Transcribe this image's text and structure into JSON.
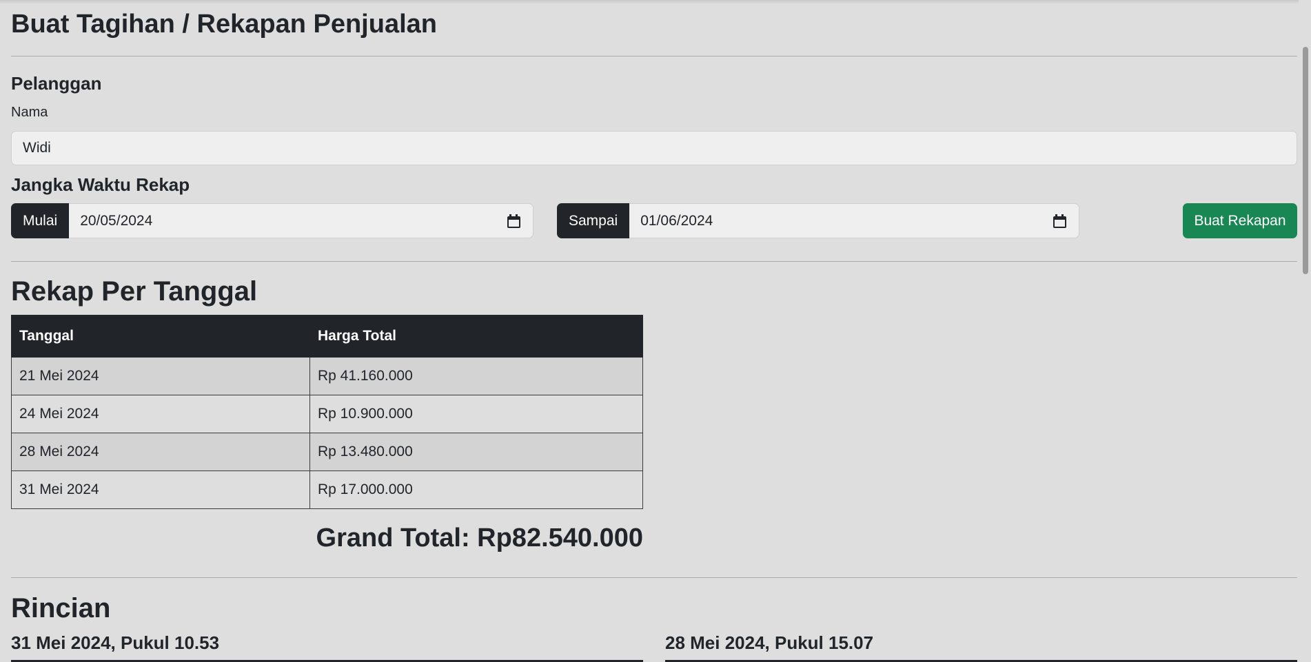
{
  "page": {
    "title": "Buat Tagihan / Rekapan Penjualan"
  },
  "customer": {
    "section_label": "Pelanggan",
    "name_label": "Nama",
    "name_value": "Widi"
  },
  "period": {
    "section_label": "Jangka Waktu Rekap",
    "start_addon": "Mulai",
    "start_value": "20/05/2024",
    "end_addon": "Sampai",
    "end_value": "01/06/2024",
    "submit_label": "Buat Rekapan"
  },
  "summary": {
    "title": "Rekap Per Tanggal",
    "columns": [
      "Tanggal",
      "Harga Total"
    ],
    "rows": [
      [
        "21 Mei 2024",
        "Rp 41.160.000"
      ],
      [
        "24 Mei 2024",
        "Rp 10.900.000"
      ],
      [
        "28 Mei 2024",
        "Rp 13.480.000"
      ],
      [
        "31 Mei 2024",
        "Rp 17.000.000"
      ]
    ],
    "grand_total": "Grand Total: Rp82.540.000"
  },
  "details": {
    "title": "Rincian",
    "entries": [
      "31 Mei 2024, Pukul 10.53",
      "28 Mei 2024, Pukul 15.07"
    ]
  },
  "colors": {
    "background": "#dedede",
    "dark": "#212529",
    "accent_green": "#198754"
  },
  "icons": {
    "date_picker": "calendar-icon"
  }
}
